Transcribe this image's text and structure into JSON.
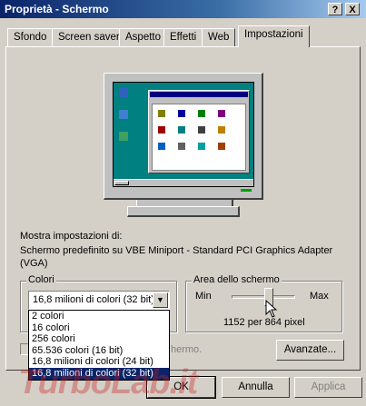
{
  "window": {
    "title": "Proprietà - Schermo",
    "help_button": "?",
    "close_button": "X"
  },
  "tabs": [
    {
      "label": "Sfondo"
    },
    {
      "label": "Screen saver"
    },
    {
      "label": "Aspetto"
    },
    {
      "label": "Effetti"
    },
    {
      "label": "Web"
    },
    {
      "label": "Impostazioni",
      "active": true
    }
  ],
  "settings": {
    "display_heading": "Mostra impostazioni di:",
    "display_device_line1": "Schermo predefinito su VBE Miniport - Standard PCI Graphics Adapter",
    "display_device_line2": "(VGA)",
    "colors_group_label": "Colori",
    "colors_selected": "16,8 milioni di colori (32 bit)",
    "colors_options": [
      "2 colori",
      "16 colori",
      "256 colori",
      "65.536 colori (16 bit)",
      "16,8 milioni di colori (24 bit)",
      "16,8 milioni di colori (32 bit)"
    ],
    "colors_highlighted_index": 5,
    "screen_area_group_label": "Area dello schermo",
    "slider_min_label": "Min",
    "slider_max_label": "Max",
    "slider_level": 0.6,
    "resolution_text": "1152 per 864 pixel",
    "extend_checkbox_fragment": "hermo.",
    "advanced_button": "Avanzate..."
  },
  "footer": {
    "ok_label": "OK",
    "cancel_label": "Annulla",
    "apply_label": "Applica"
  },
  "watermark": {
    "text": "TurboLab.it"
  },
  "colors": {
    "titlebar_start": "#0a246a",
    "face": "#d4d0c8",
    "selection": "#0a246a",
    "desktop_teal": "#008080"
  }
}
